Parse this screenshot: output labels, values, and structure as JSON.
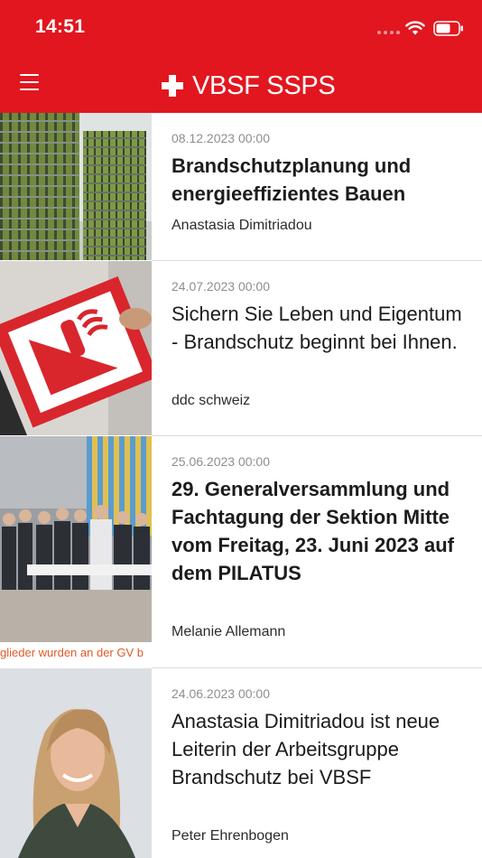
{
  "status_bar": {
    "time": "14:51"
  },
  "header": {
    "brand": "VBSF SSPS"
  },
  "articles": [
    {
      "date": "08.12.2023 00:00",
      "title": "Brandschutzplanung und energieeffizientes Bauen",
      "author": "Anastasia Dimitriadou",
      "bold": true
    },
    {
      "date": "24.07.2023 00:00",
      "title": "Sichern Sie Leben und Eigentum - Brandschutz beginnt bei Ihnen.",
      "author": "ddc schweiz",
      "bold": false
    },
    {
      "date": "25.06.2023 00:00",
      "title": "29. Generalversammlung und Fachtagung der Sektion Mitte vom Freitag, 23. Juni 2023 auf dem PILATUS",
      "author": "Melanie Allemann",
      "bold": true,
      "image_caption": "glieder wurden an der GV b"
    },
    {
      "date": "24.06.2023 00:00",
      "title": "Anastasia Dimitriadou ist neue Leiterin der Arbeitsgruppe Brandschutz bei VBSF",
      "author": "Peter Ehrenbogen",
      "bold": false
    }
  ],
  "colors": {
    "brand_red": "#e2161f",
    "date_gray": "#8e8e93",
    "title_text": "#1c1c1e",
    "separator": "#dcdcdc"
  }
}
